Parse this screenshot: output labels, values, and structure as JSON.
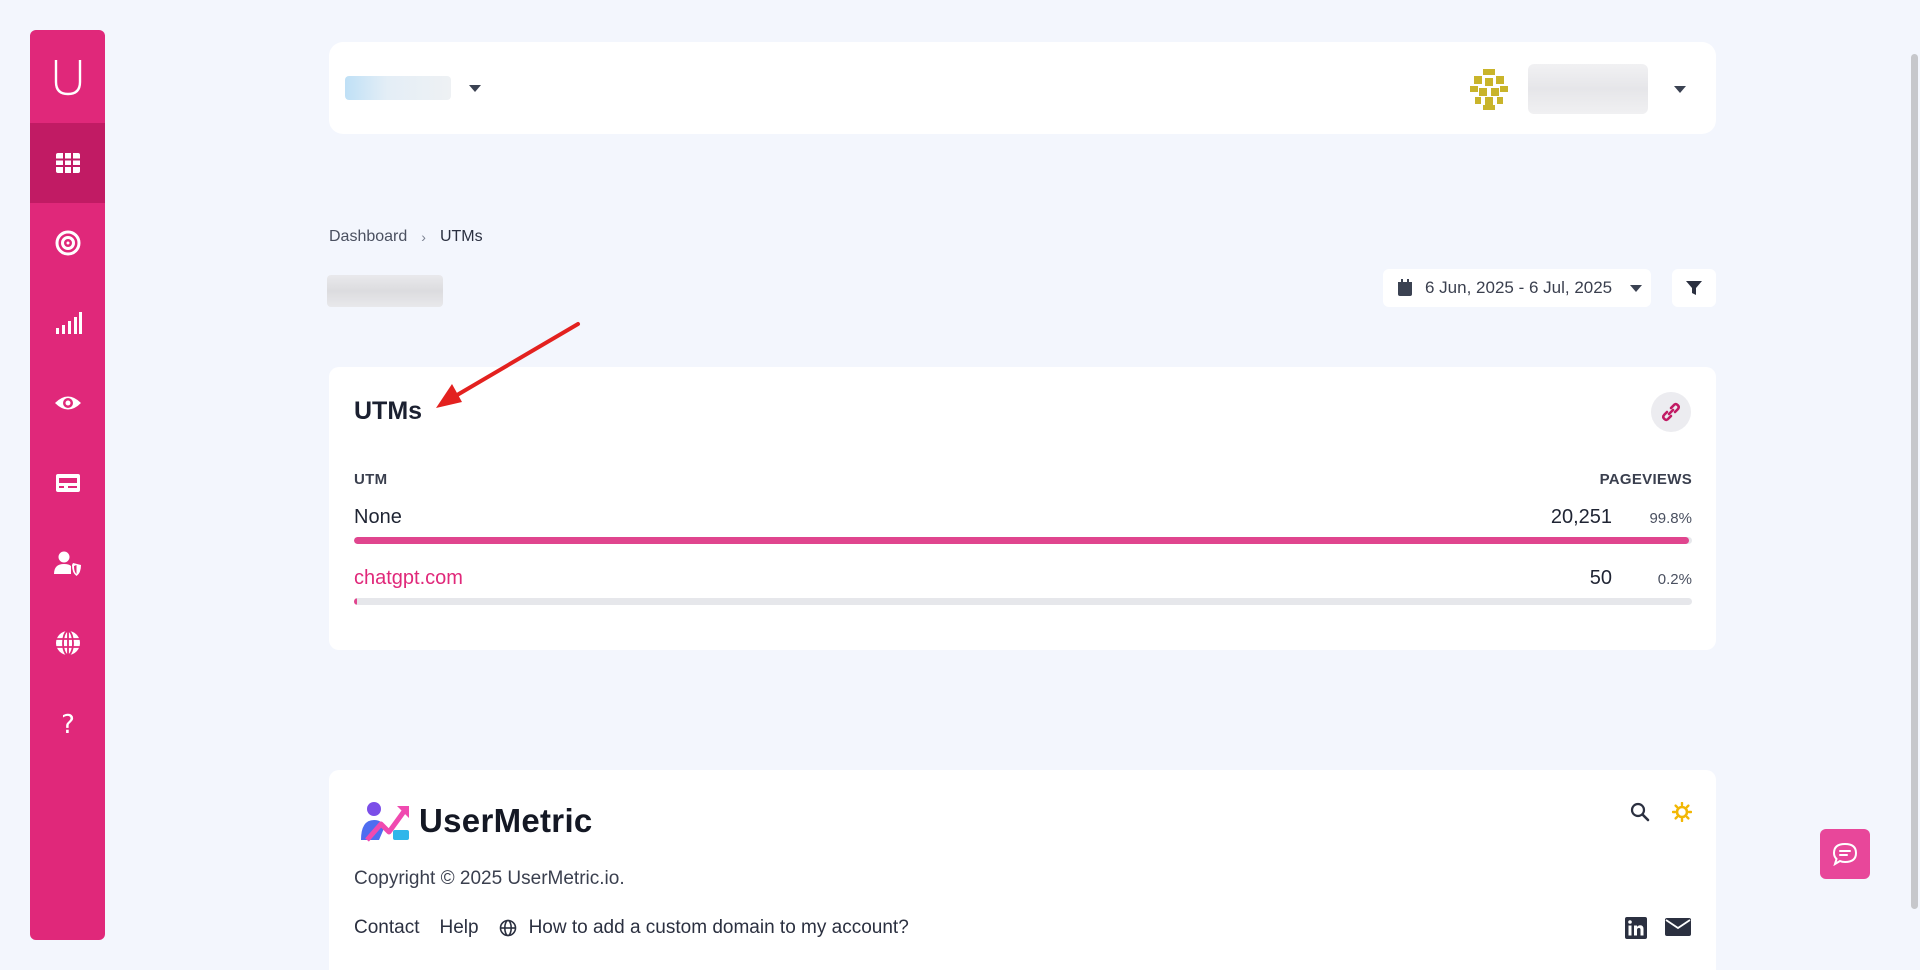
{
  "sidebar": {
    "logo_letter": "U",
    "items": [
      {
        "icon": "grid-icon",
        "active": true
      },
      {
        "icon": "target-icon"
      },
      {
        "icon": "signal-bars-icon"
      },
      {
        "icon": "eye-icon"
      },
      {
        "icon": "card-icon"
      },
      {
        "icon": "user-shield-icon"
      },
      {
        "icon": "globe-icon"
      },
      {
        "icon": "help-icon"
      }
    ]
  },
  "breadcrumb": {
    "home": "Dashboard",
    "separator": "›",
    "current": "UTMs"
  },
  "date_range": "6 Jun, 2025 - 6 Jul, 2025",
  "card": {
    "title": "UTMs",
    "col_utm": "UTM",
    "col_pageviews": "PAGEVIEWS",
    "rows": [
      {
        "label": "None",
        "value": "20,251",
        "percent": "99.8%",
        "fill": 0.998
      },
      {
        "label": "chatgpt.com",
        "value": "50",
        "percent": "0.2%",
        "fill": 0.002
      }
    ]
  },
  "footer": {
    "brand": "UserMetric",
    "copyright": "Copyright © 2025 UserMetric.io.",
    "links": {
      "contact": "Contact",
      "help": "Help",
      "custom_domain": "How to add a custom domain to my account?"
    }
  },
  "colors": {
    "brand_pink": "#e0287a",
    "sidebar_active": "#c11b64",
    "bar_fill": "#e0458e",
    "annotation_arrow": "#e3211f"
  }
}
